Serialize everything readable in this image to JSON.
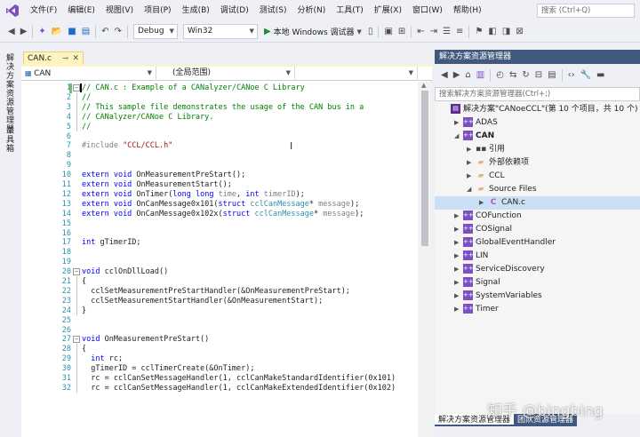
{
  "menubar": {
    "items": [
      "文件(F)",
      "编辑(E)",
      "视图(V)",
      "项目(P)",
      "生成(B)",
      "调试(D)",
      "测试(S)",
      "分析(N)",
      "工具(T)",
      "扩展(X)",
      "窗口(W)",
      "帮助(H)"
    ],
    "search_placeholder": "搜索 (Ctrl+Q)"
  },
  "toolbar": {
    "config": "Debug",
    "platform": "Win32",
    "run_label": "本地 Windows 调试器"
  },
  "left_tabs": [
    "解决方案资源管理器",
    "工具箱"
  ],
  "editor": {
    "tab_label": "CAN.c",
    "nav_project": "CAN",
    "nav_scope": "(全局范围)",
    "lines": [
      {
        "n": "1",
        "parts": [
          [
            "cm",
            "// CAN.c : Example of a CANalyzer/CANoe C Library"
          ]
        ]
      },
      {
        "n": "2",
        "parts": [
          [
            "cm",
            "//"
          ]
        ]
      },
      {
        "n": "3",
        "parts": [
          [
            "cm",
            "// This sample file demonstrates the usage of the CAN bus in a"
          ]
        ]
      },
      {
        "n": "4",
        "parts": [
          [
            "cm",
            "// CANalyzer/CANoe C Library."
          ]
        ]
      },
      {
        "n": "5",
        "parts": [
          [
            "cm",
            "//"
          ]
        ]
      },
      {
        "n": "6",
        "parts": []
      },
      {
        "n": "7",
        "parts": [
          [
            "pp",
            "#include "
          ],
          [
            "st",
            "\"CCL/CCL.h\""
          ]
        ]
      },
      {
        "n": "8",
        "parts": []
      },
      {
        "n": "9",
        "parts": []
      },
      {
        "n": "10",
        "parts": [
          [
            "kw",
            "extern "
          ],
          [
            "kw",
            "void "
          ],
          [
            "",
            "OnMeasurementPreStart();"
          ]
        ]
      },
      {
        "n": "11",
        "parts": [
          [
            "kw",
            "extern "
          ],
          [
            "kw",
            "void "
          ],
          [
            "",
            "OnMeasurementStart();"
          ]
        ]
      },
      {
        "n": "12",
        "parts": [
          [
            "kw",
            "extern "
          ],
          [
            "kw",
            "void "
          ],
          [
            "",
            "OnTimer("
          ],
          [
            "kw",
            "long long "
          ],
          [
            "pa",
            "time"
          ],
          [
            "",
            ", "
          ],
          [
            "kw",
            "int "
          ],
          [
            "pa",
            "timerID"
          ],
          [
            "",
            ");"
          ]
        ]
      },
      {
        "n": "13",
        "parts": [
          [
            "kw",
            "extern "
          ],
          [
            "kw",
            "void "
          ],
          [
            "",
            "OnCanMessage0x101("
          ],
          [
            "kw",
            "struct "
          ],
          [
            "ty",
            "cclCanMessage"
          ],
          [
            "",
            "* "
          ],
          [
            "pa",
            "message"
          ],
          [
            "",
            ");"
          ]
        ]
      },
      {
        "n": "14",
        "parts": [
          [
            "kw",
            "extern "
          ],
          [
            "kw",
            "void "
          ],
          [
            "",
            "OnCanMessage0x102x("
          ],
          [
            "kw",
            "struct "
          ],
          [
            "ty",
            "cclCanMessage"
          ],
          [
            "",
            "* "
          ],
          [
            "pa",
            "message"
          ],
          [
            "",
            ");"
          ]
        ]
      },
      {
        "n": "15",
        "parts": []
      },
      {
        "n": "16",
        "parts": []
      },
      {
        "n": "17",
        "parts": [
          [
            "kw",
            "int "
          ],
          [
            "",
            "gTimerID;"
          ]
        ]
      },
      {
        "n": "18",
        "parts": []
      },
      {
        "n": "19",
        "parts": []
      },
      {
        "n": "20",
        "parts": [
          [
            "kw",
            "void "
          ],
          [
            "",
            "cclOnDllLoad()"
          ]
        ]
      },
      {
        "n": "21",
        "parts": [
          [
            "",
            "{"
          ]
        ]
      },
      {
        "n": "22",
        "parts": [
          [
            "",
            "  cclSetMeasurementPreStartHandler(&OnMeasurementPreStart);"
          ]
        ]
      },
      {
        "n": "23",
        "parts": [
          [
            "",
            "  cclSetMeasurementStartHandler(&OnMeasurementStart);"
          ]
        ]
      },
      {
        "n": "24",
        "parts": [
          [
            "",
            "}"
          ]
        ]
      },
      {
        "n": "25",
        "parts": []
      },
      {
        "n": "26",
        "parts": []
      },
      {
        "n": "27",
        "parts": [
          [
            "kw",
            "void "
          ],
          [
            "",
            "OnMeasurementPreStart()"
          ]
        ]
      },
      {
        "n": "28",
        "parts": [
          [
            "",
            "{"
          ]
        ]
      },
      {
        "n": "29",
        "parts": [
          [
            "",
            "  "
          ],
          [
            "kw",
            "int "
          ],
          [
            "",
            "rc;"
          ]
        ]
      },
      {
        "n": "30",
        "parts": [
          [
            "",
            "  gTimerID = cclTimerCreate(&OnTimer);"
          ]
        ]
      },
      {
        "n": "31",
        "parts": [
          [
            "",
            "  rc = cclCanSetMessageHandler(1, cclCanMakeStandardIdentifier(0x101)"
          ]
        ]
      },
      {
        "n": "32",
        "parts": [
          [
            "",
            "  rc = cclCanSetMessageHandler(1, cclCanMakeExtendedIdentifier(0x102)"
          ]
        ]
      }
    ]
  },
  "solution_explorer": {
    "title": "解决方案资源管理器",
    "search_placeholder": "搜索解决方案资源管理器(Ctrl+;)",
    "tree": [
      {
        "label": "解决方案\"CANoeCCL\"(第 10 个项目，共 10 个)",
        "icon": "solution-icon",
        "expander": "",
        "indent": 0
      },
      {
        "label": "ADAS",
        "icon": "project-icon",
        "expander": "▶",
        "indent": 1
      },
      {
        "label": "CAN",
        "icon": "project-icon",
        "expander": "◢",
        "indent": 1,
        "bold": true
      },
      {
        "label": "引用",
        "icon": "references-icon",
        "expander": "▶",
        "indent": 2
      },
      {
        "label": "外部依赖项",
        "icon": "external-deps-icon",
        "expander": "▶",
        "indent": 2
      },
      {
        "label": "CCL",
        "icon": "folder-icon",
        "expander": "▶",
        "indent": 2
      },
      {
        "label": "Source Files",
        "icon": "folder-icon",
        "expander": "◢",
        "indent": 2
      },
      {
        "label": "CAN.c",
        "icon": "c-file-icon",
        "expander": "▶",
        "indent": 3,
        "selected": true
      },
      {
        "label": "COFunction",
        "icon": "project-icon",
        "expander": "▶",
        "indent": 1
      },
      {
        "label": "COSignal",
        "icon": "project-icon",
        "expander": "▶",
        "indent": 1
      },
      {
        "label": "GlobalEventHandler",
        "icon": "project-icon",
        "expander": "▶",
        "indent": 1
      },
      {
        "label": "LIN",
        "icon": "project-icon",
        "expander": "▶",
        "indent": 1
      },
      {
        "label": "ServiceDiscovery",
        "icon": "project-icon",
        "expander": "▶",
        "indent": 1
      },
      {
        "label": "Signal",
        "icon": "project-icon",
        "expander": "▶",
        "indent": 1
      },
      {
        "label": "SystemVariables",
        "icon": "project-icon",
        "expander": "▶",
        "indent": 1
      },
      {
        "label": "Timer",
        "icon": "project-icon",
        "expander": "▶",
        "indent": 1
      }
    ],
    "bottom_tabs": [
      "解决方案资源管理器",
      "团队资源管理器"
    ]
  },
  "watermark": "知乎 @bingbing"
}
